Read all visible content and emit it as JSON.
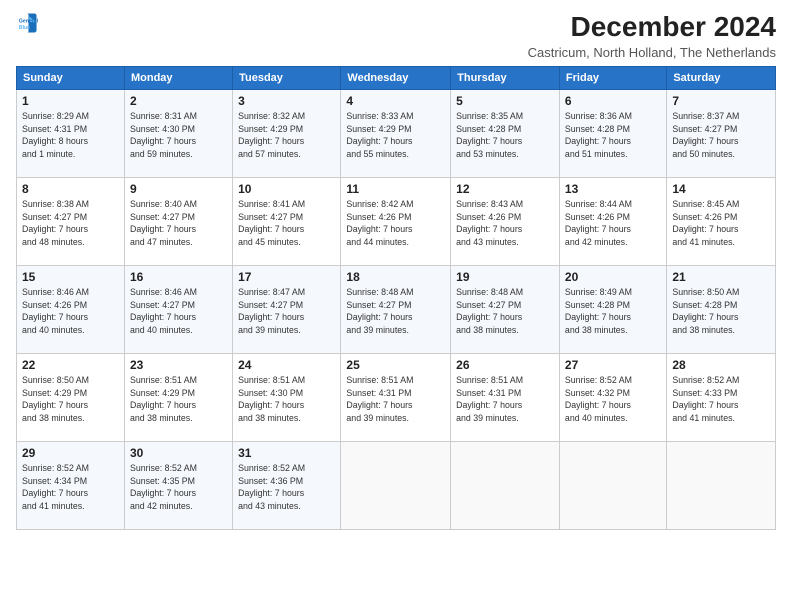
{
  "logo": {
    "line1": "General",
    "line2": "Blue"
  },
  "title": "December 2024",
  "subtitle": "Castricum, North Holland, The Netherlands",
  "header": {
    "days": [
      "Sunday",
      "Monday",
      "Tuesday",
      "Wednesday",
      "Thursday",
      "Friday",
      "Saturday"
    ]
  },
  "weeks": [
    [
      {
        "day": "1",
        "info": "Sunrise: 8:29 AM\nSunset: 4:31 PM\nDaylight: 8 hours\nand 1 minute."
      },
      {
        "day": "2",
        "info": "Sunrise: 8:31 AM\nSunset: 4:30 PM\nDaylight: 7 hours\nand 59 minutes."
      },
      {
        "day": "3",
        "info": "Sunrise: 8:32 AM\nSunset: 4:29 PM\nDaylight: 7 hours\nand 57 minutes."
      },
      {
        "day": "4",
        "info": "Sunrise: 8:33 AM\nSunset: 4:29 PM\nDaylight: 7 hours\nand 55 minutes."
      },
      {
        "day": "5",
        "info": "Sunrise: 8:35 AM\nSunset: 4:28 PM\nDaylight: 7 hours\nand 53 minutes."
      },
      {
        "day": "6",
        "info": "Sunrise: 8:36 AM\nSunset: 4:28 PM\nDaylight: 7 hours\nand 51 minutes."
      },
      {
        "day": "7",
        "info": "Sunrise: 8:37 AM\nSunset: 4:27 PM\nDaylight: 7 hours\nand 50 minutes."
      }
    ],
    [
      {
        "day": "8",
        "info": "Sunrise: 8:38 AM\nSunset: 4:27 PM\nDaylight: 7 hours\nand 48 minutes."
      },
      {
        "day": "9",
        "info": "Sunrise: 8:40 AM\nSunset: 4:27 PM\nDaylight: 7 hours\nand 47 minutes."
      },
      {
        "day": "10",
        "info": "Sunrise: 8:41 AM\nSunset: 4:27 PM\nDaylight: 7 hours\nand 45 minutes."
      },
      {
        "day": "11",
        "info": "Sunrise: 8:42 AM\nSunset: 4:26 PM\nDaylight: 7 hours\nand 44 minutes."
      },
      {
        "day": "12",
        "info": "Sunrise: 8:43 AM\nSunset: 4:26 PM\nDaylight: 7 hours\nand 43 minutes."
      },
      {
        "day": "13",
        "info": "Sunrise: 8:44 AM\nSunset: 4:26 PM\nDaylight: 7 hours\nand 42 minutes."
      },
      {
        "day": "14",
        "info": "Sunrise: 8:45 AM\nSunset: 4:26 PM\nDaylight: 7 hours\nand 41 minutes."
      }
    ],
    [
      {
        "day": "15",
        "info": "Sunrise: 8:46 AM\nSunset: 4:26 PM\nDaylight: 7 hours\nand 40 minutes."
      },
      {
        "day": "16",
        "info": "Sunrise: 8:46 AM\nSunset: 4:27 PM\nDaylight: 7 hours\nand 40 minutes."
      },
      {
        "day": "17",
        "info": "Sunrise: 8:47 AM\nSunset: 4:27 PM\nDaylight: 7 hours\nand 39 minutes."
      },
      {
        "day": "18",
        "info": "Sunrise: 8:48 AM\nSunset: 4:27 PM\nDaylight: 7 hours\nand 39 minutes."
      },
      {
        "day": "19",
        "info": "Sunrise: 8:48 AM\nSunset: 4:27 PM\nDaylight: 7 hours\nand 38 minutes."
      },
      {
        "day": "20",
        "info": "Sunrise: 8:49 AM\nSunset: 4:28 PM\nDaylight: 7 hours\nand 38 minutes."
      },
      {
        "day": "21",
        "info": "Sunrise: 8:50 AM\nSunset: 4:28 PM\nDaylight: 7 hours\nand 38 minutes."
      }
    ],
    [
      {
        "day": "22",
        "info": "Sunrise: 8:50 AM\nSunset: 4:29 PM\nDaylight: 7 hours\nand 38 minutes."
      },
      {
        "day": "23",
        "info": "Sunrise: 8:51 AM\nSunset: 4:29 PM\nDaylight: 7 hours\nand 38 minutes."
      },
      {
        "day": "24",
        "info": "Sunrise: 8:51 AM\nSunset: 4:30 PM\nDaylight: 7 hours\nand 38 minutes."
      },
      {
        "day": "25",
        "info": "Sunrise: 8:51 AM\nSunset: 4:31 PM\nDaylight: 7 hours\nand 39 minutes."
      },
      {
        "day": "26",
        "info": "Sunrise: 8:51 AM\nSunset: 4:31 PM\nDaylight: 7 hours\nand 39 minutes."
      },
      {
        "day": "27",
        "info": "Sunrise: 8:52 AM\nSunset: 4:32 PM\nDaylight: 7 hours\nand 40 minutes."
      },
      {
        "day": "28",
        "info": "Sunrise: 8:52 AM\nSunset: 4:33 PM\nDaylight: 7 hours\nand 41 minutes."
      }
    ],
    [
      {
        "day": "29",
        "info": "Sunrise: 8:52 AM\nSunset: 4:34 PM\nDaylight: 7 hours\nand 41 minutes."
      },
      {
        "day": "30",
        "info": "Sunrise: 8:52 AM\nSunset: 4:35 PM\nDaylight: 7 hours\nand 42 minutes."
      },
      {
        "day": "31",
        "info": "Sunrise: 8:52 AM\nSunset: 4:36 PM\nDaylight: 7 hours\nand 43 minutes."
      },
      {
        "day": "",
        "info": ""
      },
      {
        "day": "",
        "info": ""
      },
      {
        "day": "",
        "info": ""
      },
      {
        "day": "",
        "info": ""
      }
    ]
  ]
}
